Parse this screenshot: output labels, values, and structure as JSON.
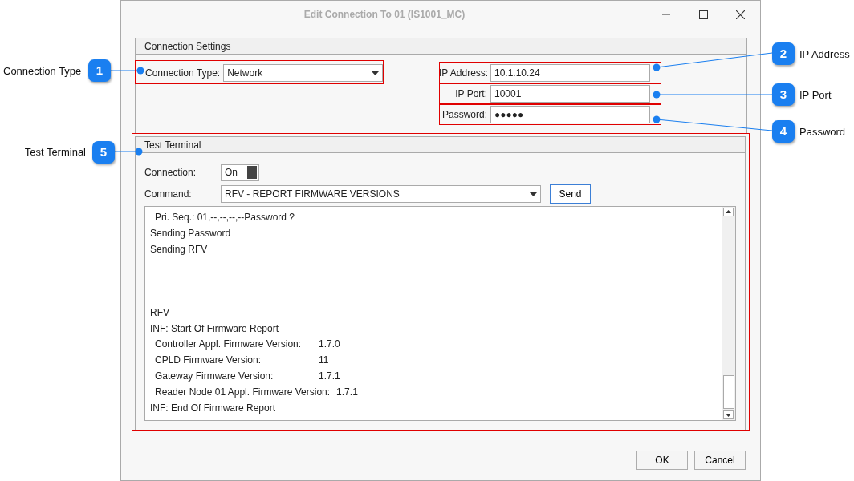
{
  "window": {
    "title": "Edit Connection To 01 (IS1001_MC)"
  },
  "connection_settings": {
    "title": "Connection Settings",
    "connection_type": {
      "label": "Connection Type:",
      "value": "Network"
    },
    "fields": [
      {
        "label": "IP Address:",
        "value": "10.1.10.24"
      },
      {
        "label": "IP Port:",
        "value": "10001"
      },
      {
        "label": "Password:",
        "value": "●●●●●"
      }
    ]
  },
  "test_terminal": {
    "title": "Test Terminal",
    "connection": {
      "label": "Connection:",
      "toggle_text": "On",
      "on": true
    },
    "command": {
      "label": "Command:",
      "value": "RFV - REPORT FIRMWARE VERSIONS"
    },
    "send_button": "Send",
    "output_lines": [
      {
        "kind": "indent",
        "text": "Pri. Seq.: 01,--,--,--,--Password ?"
      },
      {
        "kind": "plain",
        "text": "Sending Password"
      },
      {
        "kind": "plain",
        "text": "Sending RFV"
      },
      {
        "kind": "blank"
      },
      {
        "kind": "blank"
      },
      {
        "kind": "blank"
      },
      {
        "kind": "plain",
        "text": "RFV"
      },
      {
        "kind": "plain",
        "text": "INF: Start Of Firmware Report"
      },
      {
        "kind": "version",
        "text": "Controller Appl. Firmware Version:",
        "value": "1.7.0"
      },
      {
        "kind": "version",
        "text": "CPLD Firmware Version:",
        "value": "11"
      },
      {
        "kind": "version",
        "text": "Gateway Firmware Version:",
        "value": "1.7.1"
      },
      {
        "kind": "version",
        "text": "Reader Node 01 Appl. Firmware Version:",
        "value": "1.7.1"
      },
      {
        "kind": "plain",
        "text": "INF: End Of Firmware Report"
      }
    ]
  },
  "buttons": [
    "OK",
    "Cancel"
  ],
  "callouts": [
    {
      "number": "1",
      "label": "Connection Type"
    },
    {
      "number": "2",
      "label": "IP Address"
    },
    {
      "number": "3",
      "label": "IP Port"
    },
    {
      "number": "4",
      "label": "Password"
    },
    {
      "number": "5",
      "label": "Test Terminal"
    }
  ]
}
